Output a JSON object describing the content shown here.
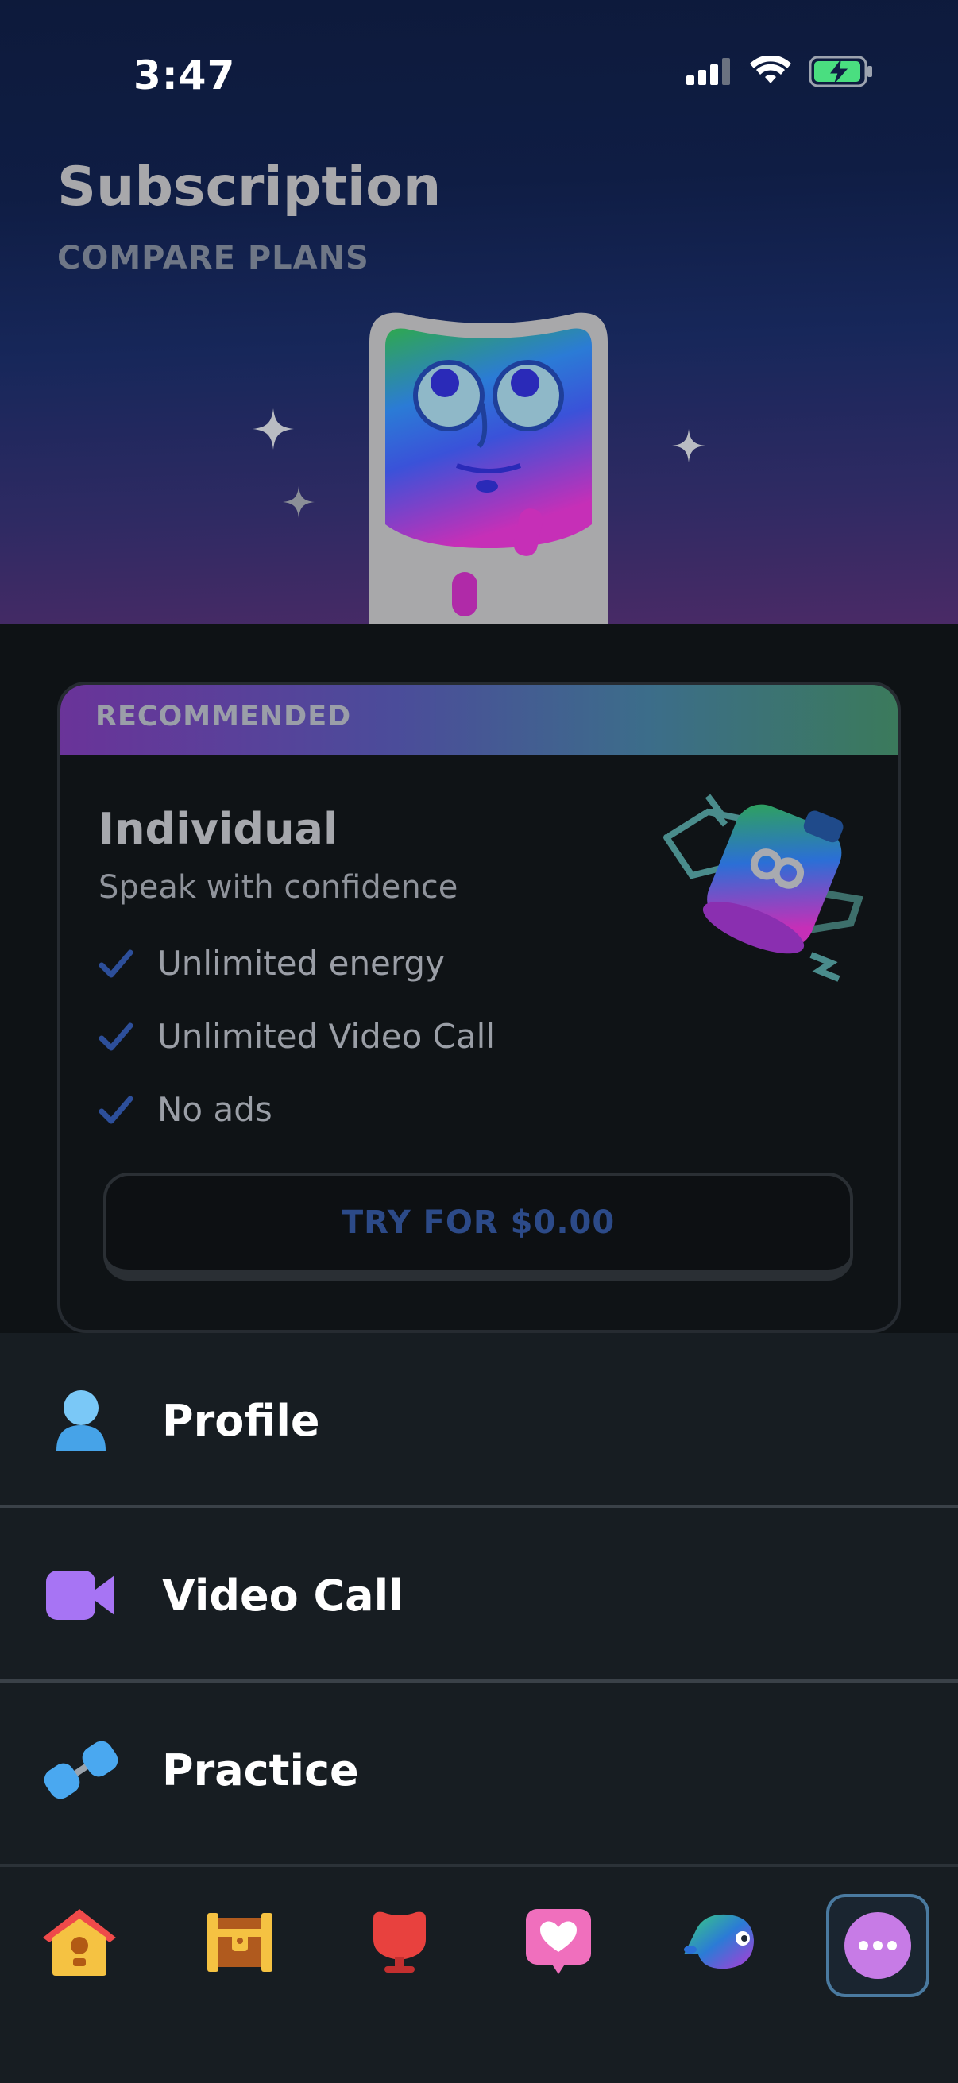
{
  "status_bar": {
    "time": "3:47"
  },
  "header": {
    "title": "Subscription",
    "subtitle": "COMPARE PLANS"
  },
  "plan_card": {
    "badge": "RECOMMENDED",
    "title": "Individual",
    "tagline": "Speak with confidence",
    "features": [
      "Unlimited energy",
      "Unlimited Video Call",
      "No ads"
    ],
    "cta_label": "TRY FOR $0.00"
  },
  "menu": {
    "items": [
      {
        "label": "Profile",
        "icon": "profile-icon"
      },
      {
        "label": "Video Call",
        "icon": "video-camera-icon"
      },
      {
        "label": "Practice",
        "icon": "dumbbell-icon"
      }
    ]
  },
  "tabs": [
    {
      "icon": "home-icon"
    },
    {
      "icon": "treasure-chest-icon"
    },
    {
      "icon": "leaderboard-trophy-icon"
    },
    {
      "icon": "heart-message-icon"
    },
    {
      "icon": "bird-icon"
    },
    {
      "icon": "more-icon",
      "selected": true
    }
  ],
  "colors": {
    "accent_blue": "#2c4a88",
    "menu_bg": "#171d22",
    "more_purple": "#c77be6"
  }
}
